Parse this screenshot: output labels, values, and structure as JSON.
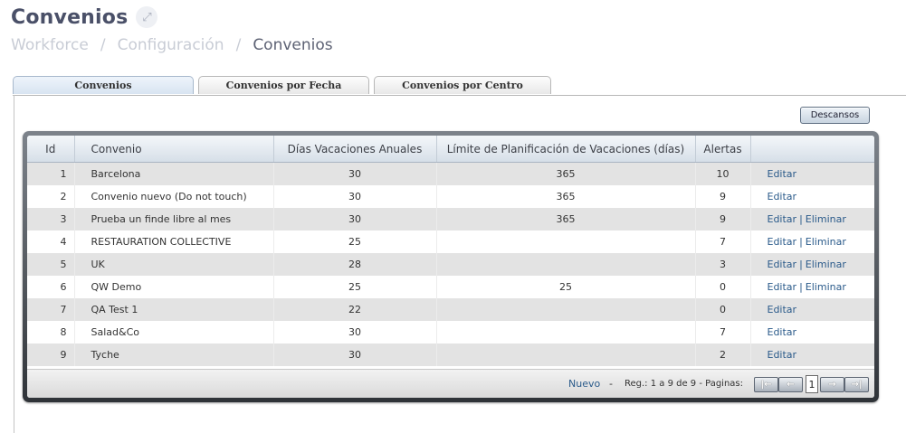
{
  "header": {
    "title": "Convenios",
    "expand_icon": "⤢",
    "breadcrumb": [
      "Workforce",
      "Configuración",
      "Convenios"
    ],
    "separator": "/"
  },
  "tabs": [
    {
      "label": "Convenios",
      "active": true
    },
    {
      "label": "Convenios por Fecha",
      "active": false
    },
    {
      "label": "Convenios por Centro",
      "active": false
    }
  ],
  "descansos_label": "Descansos",
  "table": {
    "columns": [
      "Id",
      "Convenio",
      "Días Vacaciones Anuales",
      "Límite de Planificación de Vacaciones (días)",
      "Alertas",
      ""
    ],
    "rows": [
      {
        "id": "1",
        "convenio": "Barcelona",
        "dias": "30",
        "limite": "365",
        "alertas": "10",
        "edit": "Editar",
        "delete": ""
      },
      {
        "id": "2",
        "convenio": "Convenio nuevo  (Do not touch)",
        "dias": "30",
        "limite": "365",
        "alertas": "9",
        "edit": "Editar",
        "delete": ""
      },
      {
        "id": "3",
        "convenio": "Prueba un finde libre al mes",
        "dias": "30",
        "limite": "365",
        "alertas": "9",
        "edit": "Editar",
        "delete": "Eliminar"
      },
      {
        "id": "4",
        "convenio": "RESTAURATION COLLECTIVE",
        "dias": "25",
        "limite": "",
        "alertas": "7",
        "edit": "Editar",
        "delete": "Eliminar"
      },
      {
        "id": "5",
        "convenio": "UK",
        "dias": "28",
        "limite": "",
        "alertas": "3",
        "edit": "Editar",
        "delete": "Eliminar"
      },
      {
        "id": "6",
        "convenio": "QW Demo",
        "dias": "25",
        "limite": "25",
        "alertas": "0",
        "edit": "Editar",
        "delete": "Eliminar"
      },
      {
        "id": "7",
        "convenio": "QA Test 1",
        "dias": "22",
        "limite": "",
        "alertas": "0",
        "edit": "Editar",
        "delete": ""
      },
      {
        "id": "8",
        "convenio": "Salad&Co",
        "dias": "30",
        "limite": "",
        "alertas": "7",
        "edit": "Editar",
        "delete": ""
      },
      {
        "id": "9",
        "convenio": "Tyche",
        "dias": "30",
        "limite": "",
        "alertas": "2",
        "edit": "Editar",
        "delete": ""
      }
    ],
    "action_separator": "|"
  },
  "footer": {
    "nuevo": "Nuevo",
    "dash": "-",
    "reg_text": "Reg.: 1 a 9 de 9 - Paginas:",
    "page": "1",
    "first_icon": "|←",
    "prev_icon": "←",
    "next_icon": "→",
    "last_icon": "→|"
  }
}
